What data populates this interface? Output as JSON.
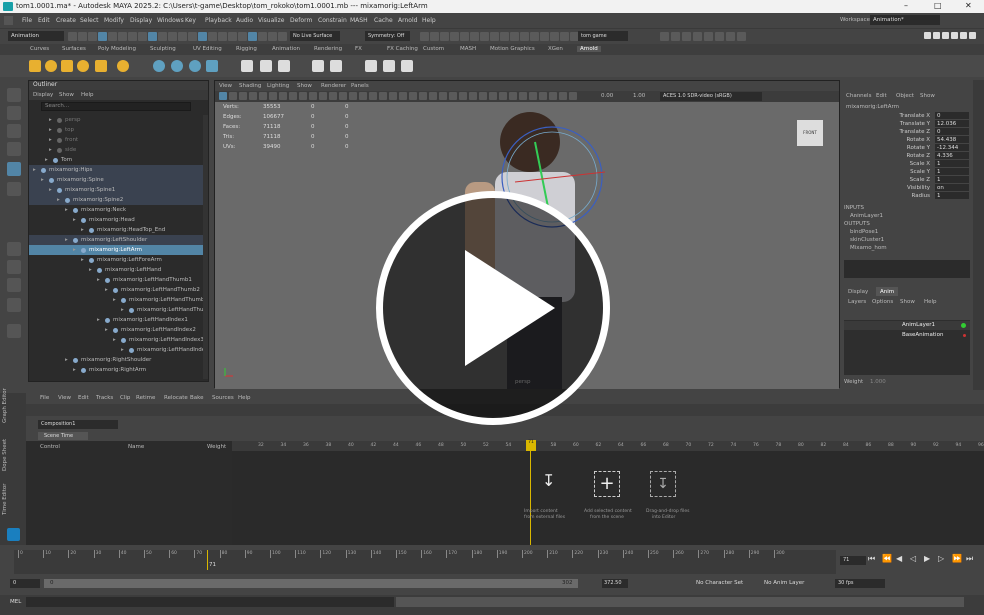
{
  "window": {
    "title": "tom1.0001.ma* - Autodesk MAYA 2025.2: C:\\Users\\t-game\\Desktop\\tom_rokoko\\tom1.0001.mb   ---  mixamorig:LeftArm"
  },
  "menu": [
    "File",
    "Edit",
    "Create",
    "Select",
    "Modify",
    "Display",
    "Windows",
    "Key",
    "Playback",
    "Audio",
    "Visualize",
    "Deform",
    "Constrain",
    "MASH",
    "Cache",
    "Arnold",
    "Help"
  ],
  "workspace": {
    "label": "Workspace:",
    "value": "Animation*"
  },
  "status": {
    "mode": "Animation",
    "live": "No Live Surface",
    "symmetry": "Symmetry: Off",
    "user": "tom game"
  },
  "shelf_tabs": [
    "Curves",
    "Surfaces",
    "Poly Modeling",
    "Sculpting",
    "UV Editing",
    "Rigging",
    "Animation",
    "Rendering",
    "FX",
    "FX Caching",
    "Custom",
    "MASH",
    "Motion Graphics",
    "XGen",
    "Arnold"
  ],
  "outliner": {
    "title": "Outliner",
    "menu": [
      "Display",
      "Show",
      "Help"
    ],
    "search_placeholder": "Search...",
    "rows": [
      {
        "label": "persp",
        "indent": 30,
        "dim": true
      },
      {
        "label": "top",
        "indent": 30,
        "dim": true
      },
      {
        "label": "front",
        "indent": 30,
        "dim": true
      },
      {
        "label": "side",
        "indent": 30,
        "dim": true
      },
      {
        "label": "Tom",
        "indent": 26
      },
      {
        "label": "mixamorig:Hips",
        "indent": 14,
        "hl": true
      },
      {
        "label": "mixamorig:Spine",
        "indent": 22,
        "hl": true
      },
      {
        "label": "mixamorig:Spine1",
        "indent": 30,
        "hl": true
      },
      {
        "label": "mixamorig:Spine2",
        "indent": 38,
        "hl": true
      },
      {
        "label": "mixamorig:Neck",
        "indent": 46
      },
      {
        "label": "mixamorig:Head",
        "indent": 54
      },
      {
        "label": "mixamorig:HeadTop_End",
        "indent": 62
      },
      {
        "label": "mixamorig:LeftShoulder",
        "indent": 46,
        "hl": true
      },
      {
        "label": "mixamorig:LeftArm",
        "indent": 54,
        "sel": true
      },
      {
        "label": "mixamorig:LeftForeArm",
        "indent": 62
      },
      {
        "label": "mixamorig:LeftHand",
        "indent": 70
      },
      {
        "label": "mixamorig:LeftHandThumb1",
        "indent": 78
      },
      {
        "label": "mixamorig:LeftHandThumb2",
        "indent": 86
      },
      {
        "label": "mixamorig:LeftHandThumb3",
        "indent": 94
      },
      {
        "label": "mixamorig:LeftHandThumb4",
        "indent": 102
      },
      {
        "label": "mixamorig:LeftHandIndex1",
        "indent": 78
      },
      {
        "label": "mixamorig:LeftHandIndex2",
        "indent": 86
      },
      {
        "label": "mixamorig:LeftHandIndex3",
        "indent": 94
      },
      {
        "label": "mixamorig:LeftHandIndex4",
        "indent": 102
      },
      {
        "label": "mixamorig:RightShoulder",
        "indent": 46
      },
      {
        "label": "mixamorig:RightArm",
        "indent": 54
      }
    ]
  },
  "viewport": {
    "menu": [
      "View",
      "Shading",
      "Lighting",
      "Show",
      "Renderer",
      "Panels"
    ],
    "exposure": "0.00",
    "gamma": "1.00",
    "colorspace": "ACES 1.0 SDR-video (sRGB)",
    "hud": [
      [
        "Verts:",
        "35553",
        "0",
        "0"
      ],
      [
        "Edges:",
        "106677",
        "0",
        "0"
      ],
      [
        "Faces:",
        "71118",
        "0",
        "0"
      ],
      [
        "Tris:",
        "71118",
        "0",
        "0"
      ],
      [
        "UVs:",
        "39490",
        "0",
        "0"
      ]
    ],
    "camera": "persp",
    "cube": "FRONT"
  },
  "channels": {
    "menu": [
      "Channels",
      "Edit",
      "Object",
      "Show"
    ],
    "object": "mixamorig:LeftArm",
    "attrs": [
      [
        "Translate X",
        "0"
      ],
      [
        "Translate Y",
        "12.036"
      ],
      [
        "Translate Z",
        "0"
      ],
      [
        "Rotate X",
        "54.438"
      ],
      [
        "Rotate Y",
        "-12.344"
      ],
      [
        "Rotate Z",
        "4.336"
      ],
      [
        "Scale X",
        "1"
      ],
      [
        "Scale Y",
        "1"
      ],
      [
        "Scale Z",
        "1"
      ],
      [
        "Visibility",
        "on"
      ],
      [
        "Radius",
        "1"
      ]
    ],
    "inputs_label": "INPUTS",
    "inputs": [
      "AnimLayer1"
    ],
    "outputs_label": "OUTPUTS",
    "outputs": [
      "bindPose1",
      "skinCluster1",
      "Mixamo_hom"
    ]
  },
  "layers": {
    "tabs": [
      "Display",
      "Anim"
    ],
    "menu": [
      "Layers",
      "Options",
      "Show",
      "Help"
    ],
    "items": [
      "AnimLayer1",
      "BaseAnimation"
    ],
    "weight_label": "Weight",
    "weight_value": "1.000"
  },
  "time_editor": {
    "menu": [
      "File",
      "View",
      "Edit",
      "Tracks",
      "Clip",
      "Retime",
      "Relocate",
      "Bake",
      "Sources",
      "Help"
    ],
    "composition": "Composition1",
    "scene_tab": "Scene Time",
    "cols": [
      "Control",
      "Name",
      "Weight"
    ],
    "ruler": [
      "32",
      "34",
      "36",
      "38",
      "40",
      "42",
      "44",
      "46",
      "48",
      "50",
      "52",
      "54",
      "56",
      "58",
      "60",
      "62",
      "64",
      "66",
      "68",
      "70",
      "72",
      "74",
      "76",
      "78",
      "80",
      "82",
      "84",
      "86",
      "88",
      "90",
      "92",
      "94",
      "96"
    ],
    "current": "71",
    "side_tabs": [
      "Graph Editor",
      "Dope Sheet",
      "Time Editor"
    ],
    "drop": [
      {
        "t1": "Import content",
        "t2": "from external files"
      },
      {
        "t1": "Add selected content",
        "t2": "from the scene"
      },
      {
        "t1": "Drag-and-drop files",
        "t2": "into Editor"
      }
    ]
  },
  "timeline": {
    "ticks": [
      "0",
      "10",
      "20",
      "30",
      "40",
      "50",
      "60",
      "70",
      "80",
      "90",
      "100",
      "110",
      "120",
      "130",
      "140",
      "150",
      "160",
      "170",
      "180",
      "190",
      "200",
      "210",
      "220",
      "230",
      "240",
      "250",
      "260",
      "270",
      "280",
      "290",
      "300"
    ],
    "current": "71",
    "current_field": "71"
  },
  "range": {
    "start": "0",
    "inner_start": "0",
    "inner_end": "302",
    "end": "372.50",
    "char": "No Character Set",
    "anim": "No Anim Layer",
    "fps": "30 fps"
  },
  "cmd": {
    "lang": "MEL"
  }
}
